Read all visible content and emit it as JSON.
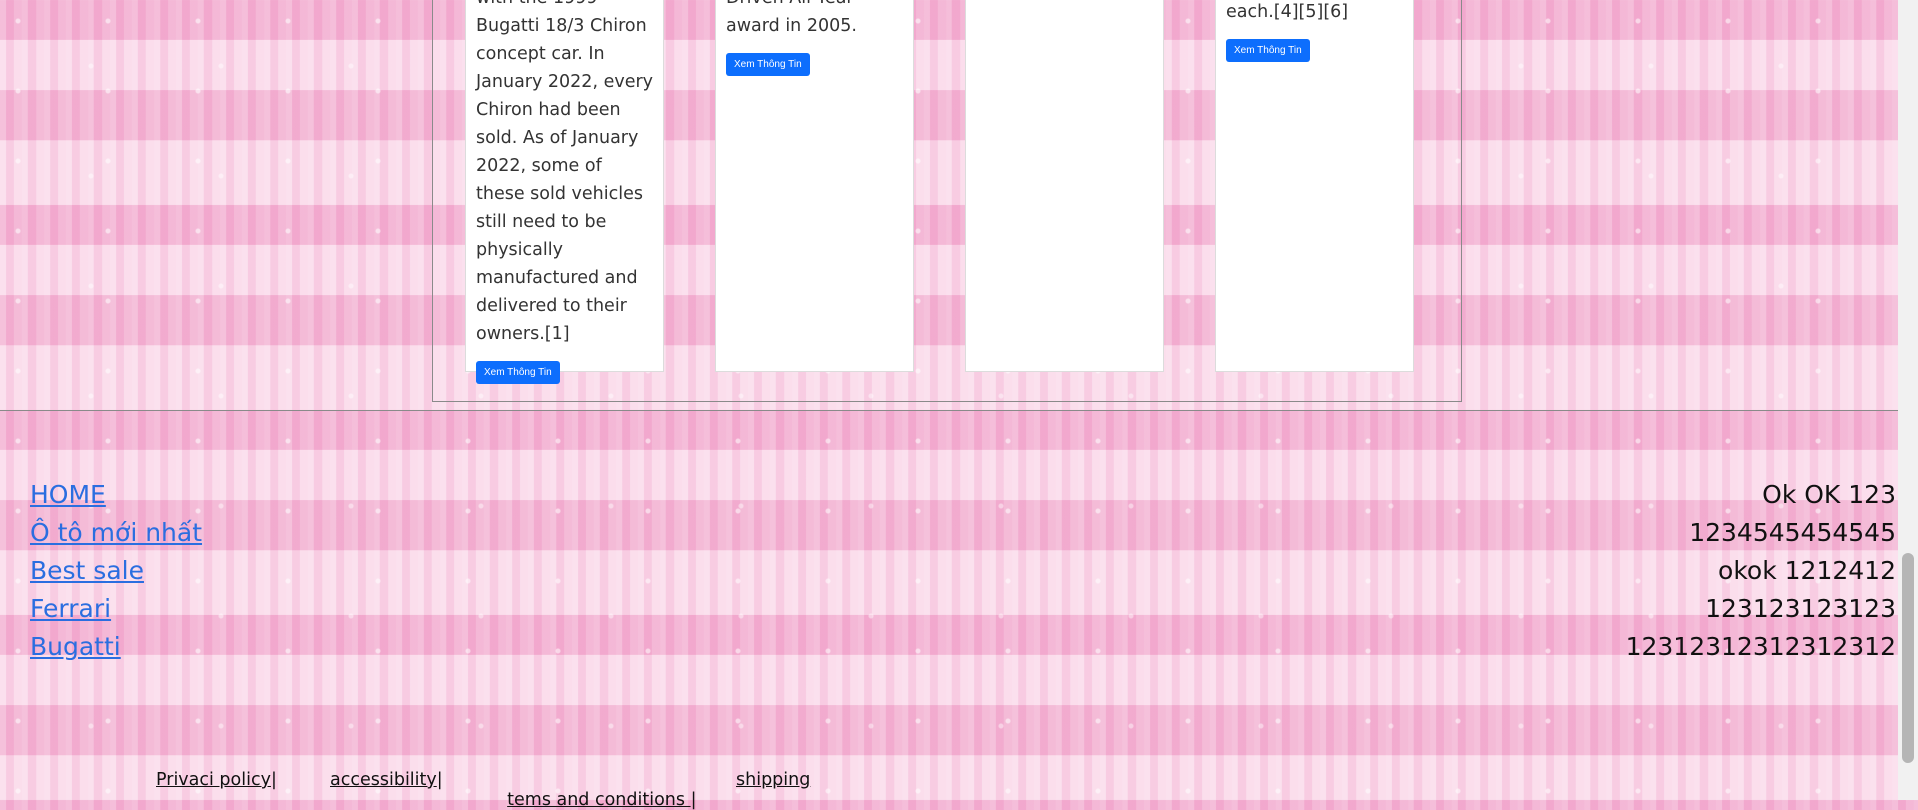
{
  "cards": [
    {
      "text": "with the 1999 Bugatti 18/3 Chiron concept car. In January 2022, every Chiron had been sold. As of January 2022, some of these sold vehicles still need to be physically manufactured and delivered to their owners.[1]",
      "button": "Xem Thông Tin"
    },
    {
      "text": "Driven All Year award in 2005.",
      "button": "Xem Thông Tin"
    },
    {
      "text": "",
      "button": ""
    },
    {
      "text": "each.[4][5][6]",
      "button": "Xem Thông Tin"
    }
  ],
  "footer_nav": [
    "HOME",
    "Ô tô mới nhất",
    "Best sale",
    "Ferrari",
    "Bugatti"
  ],
  "footer_info": [
    "Ok OK 123",
    "1234545454545",
    "okok 1212412",
    "123123123123",
    "12312312312312312"
  ],
  "legal_links": [
    {
      "label": "Privaci policy",
      "separator": "|"
    },
    {
      "label": "accessibility",
      "separator": "|"
    },
    {
      "label": "tems and conditions ",
      "separator": "|"
    },
    {
      "label": "shipping",
      "separator": ""
    }
  ],
  "colors": {
    "accent": "#0d6efd",
    "link": "#2a6ee0",
    "background": "#f4c4dc"
  }
}
